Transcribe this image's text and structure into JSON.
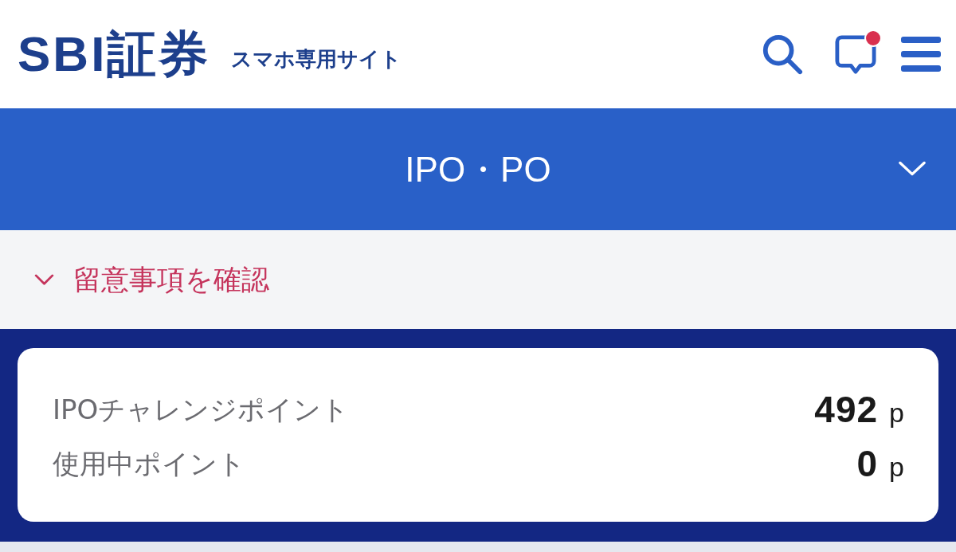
{
  "header": {
    "logo": "SBI証券",
    "subtitle": "スマホ専用サイト",
    "messages": {
      "unread": true
    }
  },
  "section_bar": {
    "title": "IPO・PO"
  },
  "notice": {
    "label": "留意事項を確認"
  },
  "points": [
    {
      "label": "IPOチャレンジポイント",
      "value": "492",
      "unit": "p"
    },
    {
      "label": "使用中ポイント",
      "value": "0",
      "unit": "p"
    }
  ]
}
